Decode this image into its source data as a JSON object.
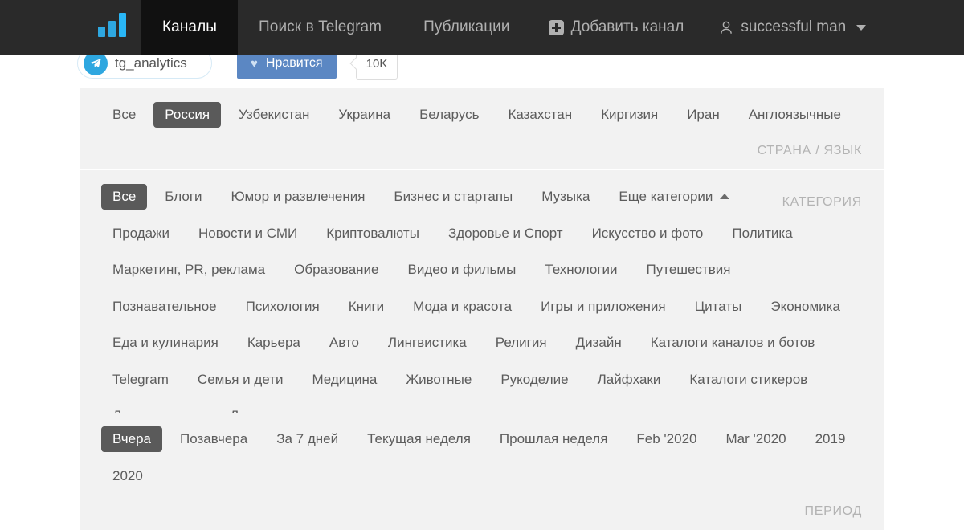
{
  "header": {
    "logo_icon": "bar-chart-logo",
    "nav": [
      {
        "label": "Каналы",
        "active": true
      },
      {
        "label": "Поиск в Telegram",
        "active": false
      },
      {
        "label": "Публикации",
        "active": false
      }
    ],
    "add_channel": {
      "label": "Добавить канал",
      "icon": "plus-square-icon"
    },
    "user": {
      "label": "successful man",
      "icon": "user-icon",
      "caret": "chevron-down-icon"
    },
    "colors": {
      "bar": "#2a2a2a",
      "active_tab": "#111111",
      "text": "#b0b0b0",
      "logo_blue": "#2ea7e0"
    }
  },
  "widget": {
    "channel_name": "tg_analytics",
    "telegram_icon": "telegram-paper-plane-icon",
    "like_label": "Нравится",
    "like_icon": "heart-icon",
    "like_count": "10K",
    "colors": {
      "like_button": "#5b87c3",
      "telegram_blue": "#2ea7e0"
    }
  },
  "filters": {
    "country": {
      "label": "СТРАНА / ЯЗЫК",
      "items": [
        {
          "label": "Все",
          "selected": false
        },
        {
          "label": "Россия",
          "selected": true
        },
        {
          "label": "Узбекистан",
          "selected": false
        },
        {
          "label": "Украина",
          "selected": false
        },
        {
          "label": "Беларусь",
          "selected": false
        },
        {
          "label": "Казахстан",
          "selected": false
        },
        {
          "label": "Киргизия",
          "selected": false
        },
        {
          "label": "Иран",
          "selected": false
        },
        {
          "label": "Англоязычные",
          "selected": false
        }
      ]
    },
    "category": {
      "label": "КАТЕГОРИЯ",
      "primary": [
        {
          "label": "Все",
          "selected": true
        },
        {
          "label": "Блоги",
          "selected": false
        },
        {
          "label": "Юмор и развлечения",
          "selected": false
        },
        {
          "label": "Бизнес и стартапы",
          "selected": false
        },
        {
          "label": "Музыка",
          "selected": false
        }
      ],
      "more_toggle": {
        "label": "Еще категории",
        "icon": "caret-up-icon",
        "expanded": true
      },
      "expanded": [
        {
          "label": "Продажи",
          "selected": false
        },
        {
          "label": "Новости и СМИ",
          "selected": false
        },
        {
          "label": "Криптовалюты",
          "selected": false
        },
        {
          "label": "Здоровье и Спорт",
          "selected": false
        },
        {
          "label": "Искусство и фото",
          "selected": false
        },
        {
          "label": "Политика",
          "selected": false
        },
        {
          "label": "Маркетинг, PR, реклама",
          "selected": false
        },
        {
          "label": "Образование",
          "selected": false
        },
        {
          "label": "Видео и фильмы",
          "selected": false
        },
        {
          "label": "Технологии",
          "selected": false
        },
        {
          "label": "Путешествия",
          "selected": false
        },
        {
          "label": "Познавательное",
          "selected": false
        },
        {
          "label": "Психология",
          "selected": false
        },
        {
          "label": "Книги",
          "selected": false
        },
        {
          "label": "Мода и красота",
          "selected": false
        },
        {
          "label": "Игры и приложения",
          "selected": false
        },
        {
          "label": "Цитаты",
          "selected": false
        },
        {
          "label": "Экономика",
          "selected": false
        },
        {
          "label": "Еда и кулинария",
          "selected": false
        },
        {
          "label": "Карьера",
          "selected": false
        },
        {
          "label": "Авто",
          "selected": false
        },
        {
          "label": "Лингвистика",
          "selected": false
        },
        {
          "label": "Религия",
          "selected": false
        },
        {
          "label": "Дизайн",
          "selected": false
        },
        {
          "label": "Каталоги каналов и ботов",
          "selected": false
        },
        {
          "label": "Telegram",
          "selected": false
        },
        {
          "label": "Семья и дети",
          "selected": false
        },
        {
          "label": "Медицина",
          "selected": false
        },
        {
          "label": "Животные",
          "selected": false
        },
        {
          "label": "Рукоделие",
          "selected": false
        },
        {
          "label": "Лайфхаки",
          "selected": false
        },
        {
          "label": "Каталоги стикеров",
          "selected": false
        },
        {
          "label": "Для взрослых",
          "selected": false
        },
        {
          "label": "Другое",
          "selected": false
        }
      ]
    },
    "period": {
      "label": "ПЕРИОД",
      "items": [
        {
          "label": "Вчера",
          "selected": true
        },
        {
          "label": "Позавчера",
          "selected": false
        },
        {
          "label": "За 7 дней",
          "selected": false
        },
        {
          "label": "Текущая неделя",
          "selected": false
        },
        {
          "label": "Прошлая неделя",
          "selected": false
        },
        {
          "label": "Feb '2020",
          "selected": false
        },
        {
          "label": "Mar '2020",
          "selected": false
        },
        {
          "label": "2019",
          "selected": false
        },
        {
          "label": "2020",
          "selected": false
        }
      ]
    }
  }
}
